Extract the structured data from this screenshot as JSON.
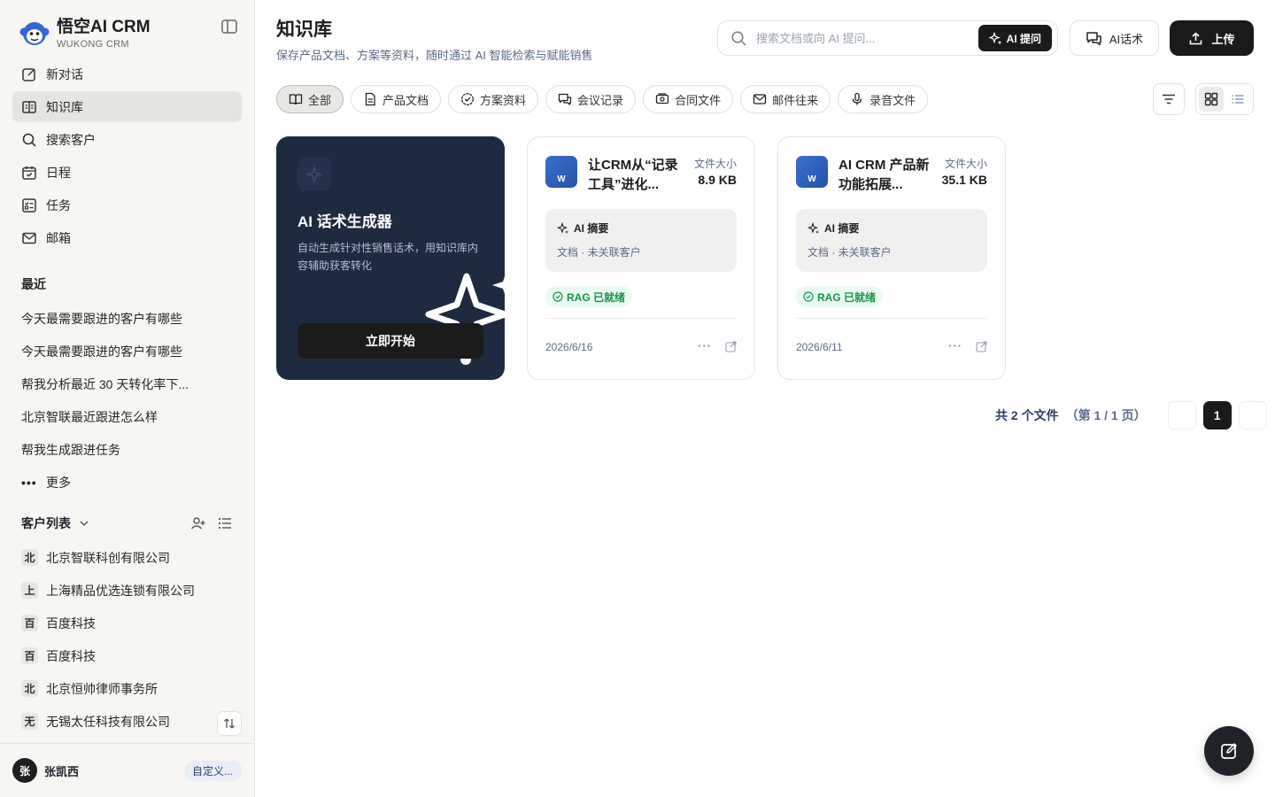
{
  "brand": {
    "name": "悟空AI CRM",
    "sub": "WUKONG CRM"
  },
  "nav": [
    {
      "label": "新对话",
      "icon": "edit-icon"
    },
    {
      "label": "知识库",
      "icon": "book-icon",
      "active": true
    },
    {
      "label": "搜索客户",
      "icon": "search-icon"
    },
    {
      "label": "日程",
      "icon": "calendar-icon"
    },
    {
      "label": "任务",
      "icon": "task-icon"
    },
    {
      "label": "邮箱",
      "icon": "mail-icon"
    }
  ],
  "recent": {
    "title": "最近",
    "items": [
      "今天最需要跟进的客户有哪些",
      "今天最需要跟进的客户有哪些",
      "帮我分析最近 30 天转化率下...",
      "北京智联最近跟进怎么样",
      "帮我生成跟进任务"
    ],
    "more_label": "更多"
  },
  "customers": {
    "title": "客户列表",
    "items": [
      {
        "badge": "北",
        "name": "北京智联科创有限公司"
      },
      {
        "badge": "上",
        "name": "上海精品优选连锁有限公司"
      },
      {
        "badge": "百",
        "name": "百度科技"
      },
      {
        "badge": "百",
        "name": "百度科技"
      },
      {
        "badge": "北",
        "name": "北京恒帅律师事务所"
      },
      {
        "badge": "无",
        "name": "无锡太任科技有限公司"
      }
    ]
  },
  "user": {
    "avatar": "张",
    "name": "张凯西",
    "tag": "自定义..."
  },
  "header": {
    "title": "知识库",
    "desc": "保存产品文档、方案等资料，随时通过 AI 智能检索与赋能销售",
    "search_placeholder": "搜索文档或向 AI 提问...",
    "ai_ask_label": "AI 提问",
    "script_label": "AI话术",
    "upload_label": "上传"
  },
  "filters": [
    {
      "label": "全部",
      "icon": "book-open-icon",
      "active": true
    },
    {
      "label": "产品文档",
      "icon": "file-icon"
    },
    {
      "label": "方案资料",
      "icon": "badge-check-icon"
    },
    {
      "label": "会议记录",
      "icon": "chat-icon"
    },
    {
      "label": "合同文件",
      "icon": "contract-icon"
    },
    {
      "label": "邮件往来",
      "icon": "mail-icon"
    },
    {
      "label": "录音文件",
      "icon": "mic-icon"
    }
  ],
  "promo": {
    "title": "AI 话术生成器",
    "desc": "自动生成针对性销售话术，用知识库内容辅助获客转化",
    "button": "立即开始"
  },
  "docs": [
    {
      "name": "让CRM从“记录工具”进化...",
      "size_label": "文件大小",
      "size": "8.9 KB",
      "summary_title": "AI 摘要",
      "summary_text": "文档 · 未关联客户",
      "rag": "RAG 已就绪",
      "date": "2026/6/16",
      "more": "···"
    },
    {
      "name": "AI CRM 产品新功能拓展...",
      "size_label": "文件大小",
      "size": "35.1 KB",
      "summary_title": "AI 摘要",
      "summary_text": "文档 · 未关联客户",
      "rag": "RAG 已就绪",
      "date": "2026/6/11",
      "more": "···"
    }
  ],
  "pager": {
    "summary": "共 2 个文件",
    "page_info": "（第 1 / 1 页）",
    "current": "1"
  },
  "colors": {
    "accent": "#1a1a1a",
    "promo_bg": "#1e2a3f",
    "rag_green": "#18944d",
    "word_blue": "#2f5fbf"
  }
}
